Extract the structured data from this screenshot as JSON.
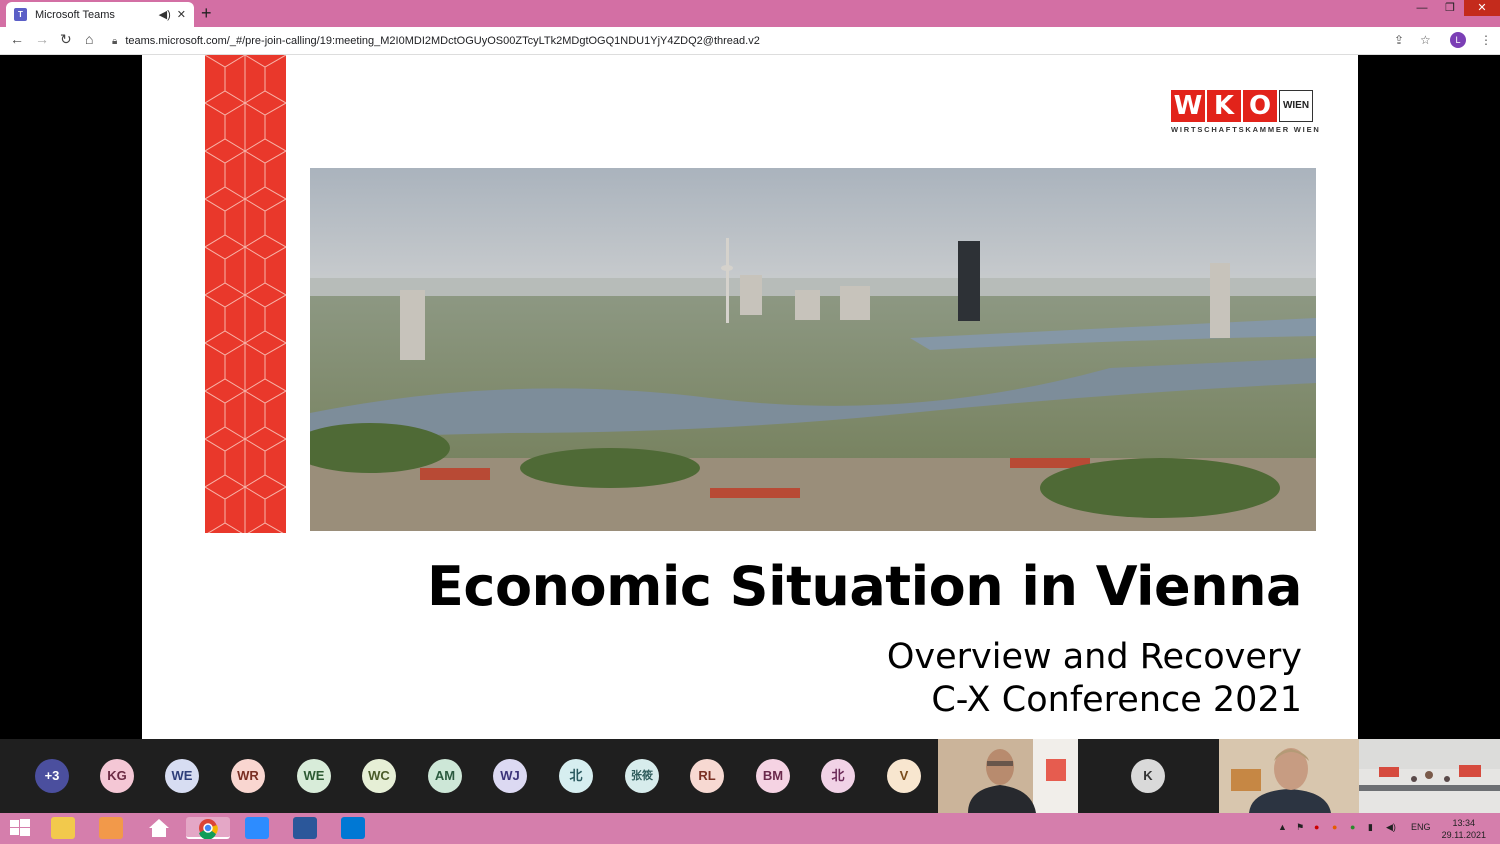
{
  "browser": {
    "tab_title": "Microsoft Teams",
    "url": "teams.microsoft.com/_#/pre-join-calling/19:meeting_M2I0MDI2MDctOGUyOS00ZTcyLTk2MDgtOGQ1NDU1YjY4ZDQ2@thread.v2",
    "profile_initial": "L"
  },
  "slide": {
    "logo_letters": [
      "W",
      "K",
      "O"
    ],
    "logo_wien": "WIEN",
    "logo_subtitle": "WIRTSCHAFTSKAMMER WIEN",
    "title": "Economic Situation in Vienna",
    "subtitle_line1": "Overview and Recovery",
    "subtitle_line2": "C-X Conference 2021"
  },
  "participants": [
    {
      "label": "+3",
      "bg": "#4b4f9e",
      "fg": "#ffffff"
    },
    {
      "label": "KG",
      "bg": "#f4c7d5",
      "fg": "#6b2a43"
    },
    {
      "label": "WE",
      "bg": "#d7ddf2",
      "fg": "#2f3f7a"
    },
    {
      "label": "WR",
      "bg": "#f9d6d0",
      "fg": "#7a2f24"
    },
    {
      "label": "WE",
      "bg": "#d8ecd9",
      "fg": "#2d5a33"
    },
    {
      "label": "WC",
      "bg": "#e6efd6",
      "fg": "#4a5c2a"
    },
    {
      "label": "AM",
      "bg": "#cde7d7",
      "fg": "#2b5a3f"
    },
    {
      "label": "WJ",
      "bg": "#dcd9f2",
      "fg": "#3c347a"
    },
    {
      "label": "北",
      "bg": "#d6eef0",
      "fg": "#2b5a60"
    },
    {
      "label": "张筱",
      "bg": "#d7ecec",
      "fg": "#2d5a5a"
    },
    {
      "label": "RL",
      "bg": "#f7d9d2",
      "fg": "#7a3124"
    },
    {
      "label": "BM",
      "bg": "#f5d3e3",
      "fg": "#6b2a4c"
    },
    {
      "label": "北",
      "bg": "#f1d2e6",
      "fg": "#6b2a58"
    },
    {
      "label": "V",
      "bg": "#f8e6cf",
      "fg": "#7a4c1c"
    },
    {
      "label": "K",
      "bg": "#d9d9d9",
      "fg": "#333333"
    }
  ],
  "system": {
    "language": "ENG",
    "time": "13:34",
    "date": "29.11.2021"
  }
}
